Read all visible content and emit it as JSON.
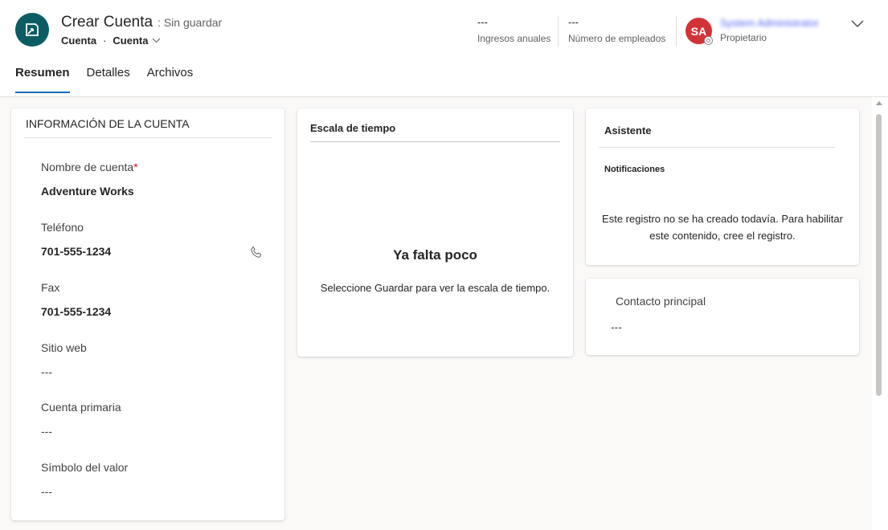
{
  "header": {
    "title": "Crear Cuenta",
    "unsaved": ": Sin guardar",
    "breadcrumb": [
      "Cuenta",
      "·",
      "Cuenta"
    ],
    "fields": [
      {
        "value": "---",
        "label": "Ingresos anuales"
      },
      {
        "value": "---",
        "label": "Número de empleados"
      }
    ],
    "owner": {
      "initials": "SA",
      "name": "System Administrator",
      "label": "Propietario"
    }
  },
  "tabs": [
    {
      "label": "Resumen",
      "active": true
    },
    {
      "label": "Detalles"
    },
    {
      "label": "Archivos"
    }
  ],
  "account_info": {
    "title": "INFORMACIÓN DE LA CUENTA",
    "fields": [
      {
        "label": "Nombre de cuenta",
        "required": "*",
        "value": "Adventure Works"
      },
      {
        "label": "Teléfono",
        "value": "701-555-1234"
      },
      {
        "label": "Fax",
        "value": "701-555-1234"
      },
      {
        "label": "Sitio web",
        "value": "---"
      },
      {
        "label": "Cuenta primaria",
        "value": "---"
      },
      {
        "label": "Símbolo del valor",
        "value": "---"
      }
    ]
  },
  "timeline": {
    "title": "Escala de tiempo",
    "heading": "Ya falta poco",
    "message": "Seleccione Guardar para ver la escala de tiempo."
  },
  "assistant": {
    "title": "Asistente",
    "notifications": "Notificaciones",
    "message": "Este registro no se ha creado todavía. Para habilitar este contenido, cree el registro."
  },
  "primary_contact": {
    "label": "Contacto principal",
    "value": "---"
  },
  "icons": [
    "account-entity-icon",
    "chevron-down-icon",
    "expand-header-icon",
    "phone-icon",
    "presence-icon"
  ]
}
